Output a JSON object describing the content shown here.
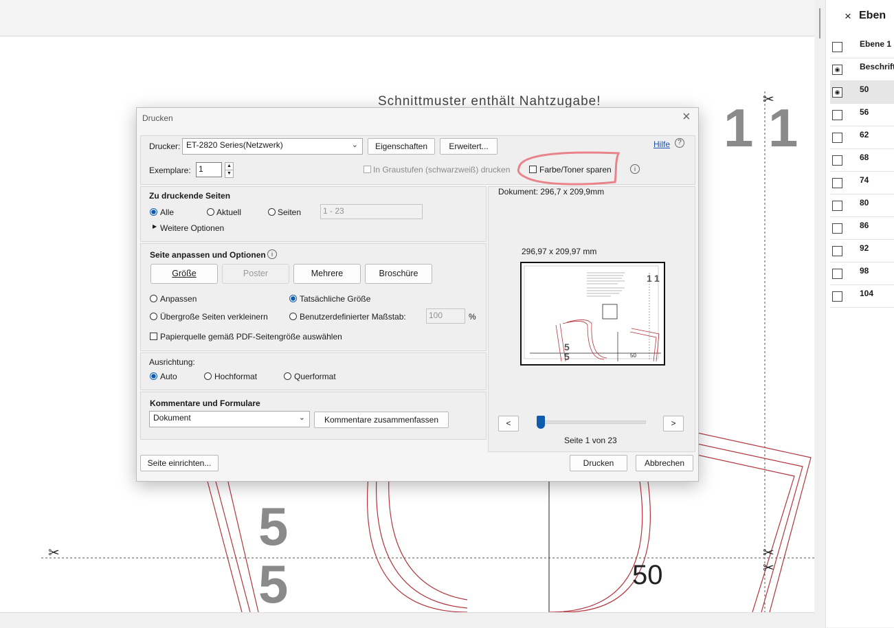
{
  "canvas": {
    "header_text": "Schnittmuster enthält Nahtzugabe!",
    "top_numbers": [
      "1",
      "1"
    ],
    "left_numbers": [
      "5",
      "5"
    ],
    "size_label": "50"
  },
  "layers_panel": {
    "close_icon": "×",
    "title": "Eben",
    "items": [
      {
        "label": "Ebene 1",
        "visible": false
      },
      {
        "label": "Beschrift",
        "visible": true
      },
      {
        "label": "50",
        "visible": true,
        "selected": true
      },
      {
        "label": "56",
        "visible": false
      },
      {
        "label": "62",
        "visible": false
      },
      {
        "label": "68",
        "visible": false
      },
      {
        "label": "74",
        "visible": false
      },
      {
        "label": "80",
        "visible": false
      },
      {
        "label": "86",
        "visible": false
      },
      {
        "label": "92",
        "visible": false
      },
      {
        "label": "98",
        "visible": false
      },
      {
        "label": "104",
        "visible": false
      }
    ]
  },
  "dialog": {
    "title": "Drucken",
    "close_icon": "×",
    "printer_label": "Drucker:",
    "printer_value": "ET-2820 Series(Netzwerk)",
    "properties_button": "Eigenschaften",
    "advanced_button": "Erweitert...",
    "help_link": "Hilfe",
    "copies_label": "Exemplare:",
    "copies_value": "1",
    "grayscale_label": "In Graustufen (schwarzweiß) drucken",
    "toner_label": "Farbe/Toner sparen",
    "pages_section": {
      "title": "Zu druckende Seiten",
      "all": "Alle",
      "current": "Aktuell",
      "pages": "Seiten",
      "pages_value": "1 - 23",
      "more_options": "Weitere Optionen"
    },
    "fit_section": {
      "title": "Seite anpassen und Optionen",
      "size_button": "Größe",
      "poster_button": "Poster",
      "multiple_button": "Mehrere",
      "booklet_button": "Broschüre",
      "fit": "Anpassen",
      "actual_size": "Tatsächliche Größe",
      "shrink": "Übergroße Seiten verkleinern",
      "custom_scale": "Benutzerdefinierter Maßstab:",
      "scale_value": "100",
      "scale_unit": "%",
      "paper_source": "Papierquelle gemäß PDF-Seitengröße auswählen"
    },
    "orientation_section": {
      "title": "Ausrichtung:",
      "auto": "Auto",
      "portrait": "Hochformat",
      "landscape": "Querformat"
    },
    "comments_section": {
      "title": "Kommentare und Formulare",
      "select_value": "Dokument",
      "summarize_button": "Kommentare zusammenfassen"
    },
    "preview": {
      "document_size": "Dokument: 296,7 x 209,9mm",
      "page_size": "296,97 x 209,97 mm",
      "thumb_number": "50",
      "prev_button": "<",
      "next_button": ">",
      "page_indicator": "Seite 1 von 23",
      "slider_fraction": 0.0
    },
    "page_setup_button": "Seite einrichten...",
    "print_button": "Drucken",
    "cancel_button": "Abbrechen"
  },
  "colors": {
    "accent": "#0f5cae",
    "pattern_line": "#b3343f",
    "highlight": "#e8838a",
    "link": "#1a4fb3"
  }
}
